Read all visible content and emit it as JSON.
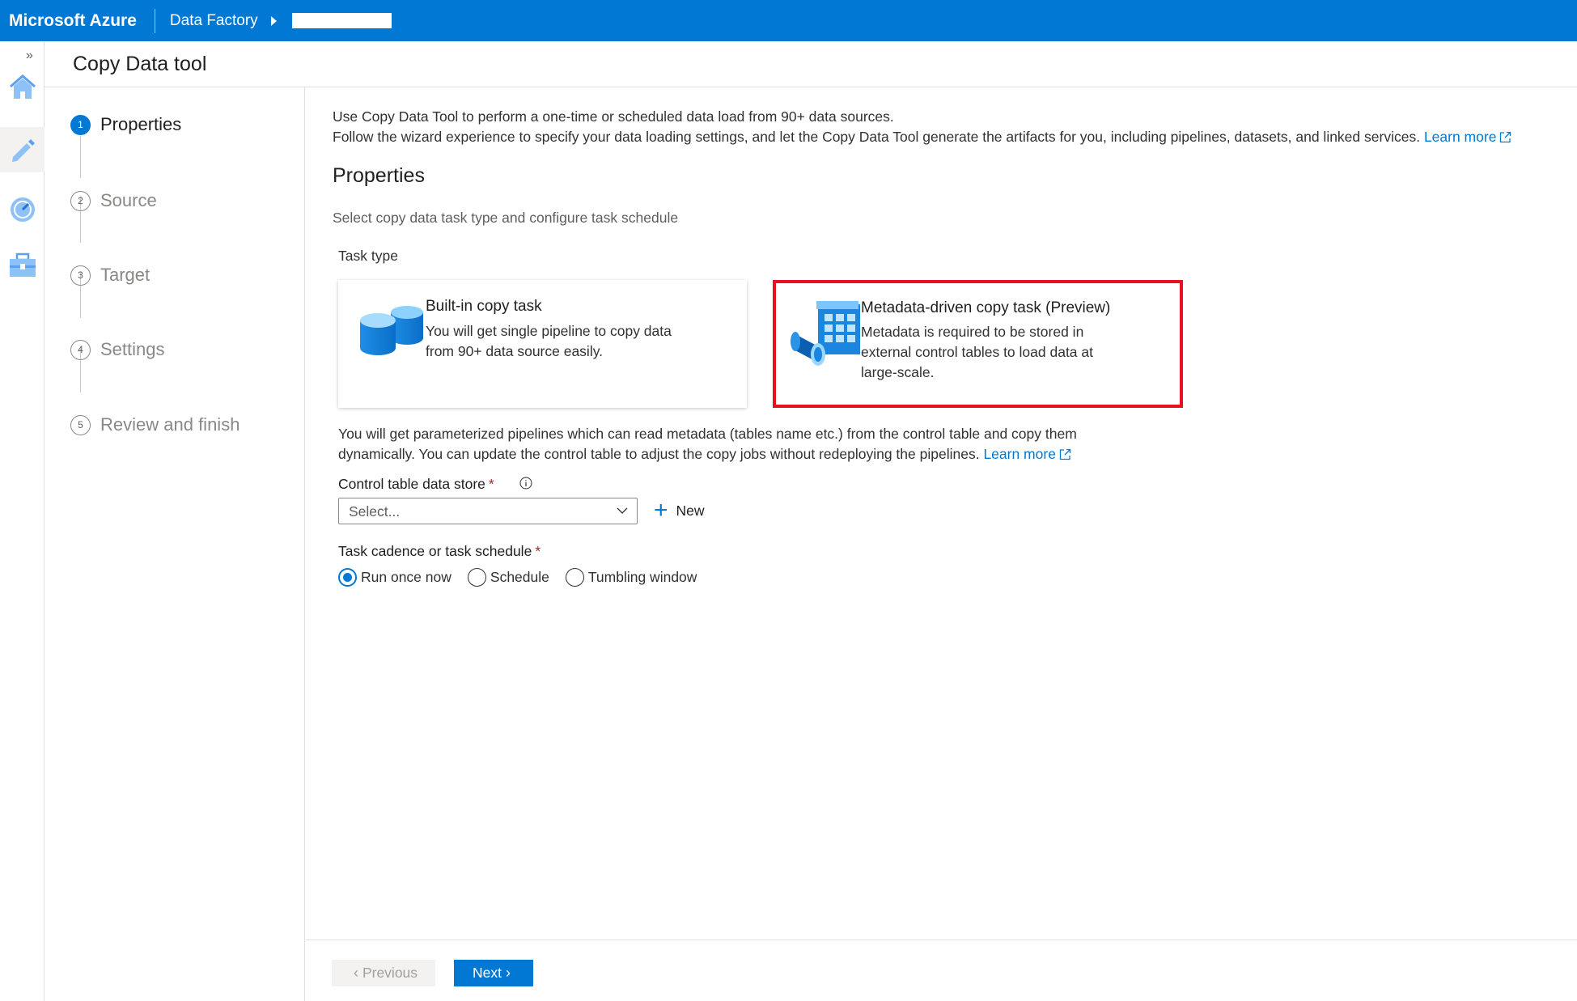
{
  "topbar": {
    "brand": "Microsoft Azure",
    "breadcrumb": "Data Factory"
  },
  "page": {
    "title": "Copy Data tool"
  },
  "steps": [
    {
      "number": "1",
      "label": "Properties",
      "current": true
    },
    {
      "number": "2",
      "label": "Source",
      "current": false
    },
    {
      "number": "3",
      "label": "Target",
      "current": false
    },
    {
      "number": "4",
      "label": "Settings",
      "current": false
    },
    {
      "number": "5",
      "label": "Review and finish",
      "current": false
    }
  ],
  "intro": {
    "line1": "Use Copy Data Tool to perform a one-time or scheduled data load from 90+ data sources.",
    "line2": "Follow the wizard experience to specify your data loading settings, and let the Copy Data Tool generate the artifacts for you, including pipelines, datasets, and linked services.",
    "learn_more": "Learn more"
  },
  "properties": {
    "title": "Properties",
    "subtitle": "Select copy data task type and configure task schedule",
    "task_type_label": "Task type"
  },
  "cards": {
    "builtin": {
      "title": "Built-in copy task",
      "desc_line1": "You will get single pipeline to copy data",
      "desc_line2": "from 90+ data source easily."
    },
    "metadata": {
      "title": "Metadata-driven copy task (Preview)",
      "desc_line1": "Metadata is required to be stored in",
      "desc_line2": "external control tables to load data at",
      "desc_line3": "large-scale."
    }
  },
  "param_note": {
    "line1": "You will get parameterized pipelines which can read metadata (tables name etc.) from the control table and copy them",
    "line2": "dynamically. You can update the control table to adjust the copy jobs without redeploying the pipelines.",
    "learn_more": "Learn more"
  },
  "control_store": {
    "label": "Control table data store",
    "required": "*",
    "placeholder": "Select...",
    "new_label": "New"
  },
  "cadence": {
    "label": "Task cadence or task schedule",
    "required": "*",
    "options": [
      "Run once now",
      "Schedule",
      "Tumbling window"
    ],
    "selected": "Run once now"
  },
  "footer": {
    "previous": "Previous",
    "next": "Next"
  },
  "colors": {
    "accent": "#0078d4",
    "highlight_border": "#e81123"
  }
}
